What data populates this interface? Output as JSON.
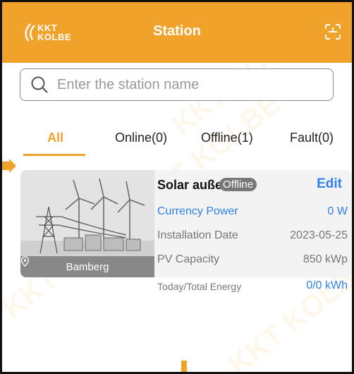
{
  "header": {
    "logo_line1": "KKT",
    "logo_line2": "KOLBE",
    "title": "Station",
    "scan_icon": "scan-icon"
  },
  "search": {
    "placeholder": "Enter the station name",
    "value": "",
    "icon": "search-icon"
  },
  "tabs": [
    {
      "label": "All",
      "active": true
    },
    {
      "label": "Online(0)",
      "active": false
    },
    {
      "label": "Offline(1)",
      "active": false
    },
    {
      "label": "Fault(0)",
      "active": false
    }
  ],
  "station": {
    "name": "Solar außen",
    "status": "Offline",
    "edit_label": "Edit",
    "location": "Bamberg",
    "rows": [
      {
        "label": "Currency Power",
        "value": "0 W"
      },
      {
        "label": "Installation Date",
        "value": "2023-05-25"
      },
      {
        "label": "PV Capacity",
        "value": "850 kWp"
      },
      {
        "label": "Today/Total Energy",
        "value": "0/0 kWh"
      }
    ]
  },
  "watermark": "KKT KOLBE",
  "colors": {
    "accent": "#f0a22b",
    "link": "#2f80ed",
    "status_badge": "#777777"
  }
}
